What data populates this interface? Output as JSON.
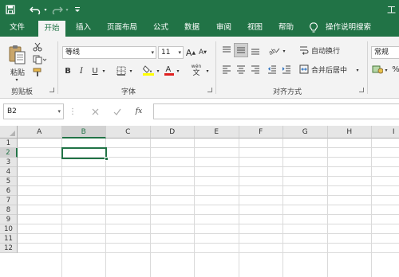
{
  "quick_access": {
    "save_icon": "save-icon",
    "undo_icon": "undo-icon",
    "redo_icon": "redo-icon",
    "customize_icon": "customize-qat-icon"
  },
  "title_right": "工",
  "tabs": [
    {
      "label": "文件"
    },
    {
      "label": "开始",
      "active": true
    },
    {
      "label": "插入"
    },
    {
      "label": "页面布局"
    },
    {
      "label": "公式"
    },
    {
      "label": "数据"
    },
    {
      "label": "审阅"
    },
    {
      "label": "视图"
    },
    {
      "label": "帮助"
    }
  ],
  "tell_me": "操作说明搜索",
  "ribbon": {
    "clipboard": {
      "paste_label": "粘贴",
      "group_label": "剪贴板"
    },
    "font": {
      "font_name": "等线",
      "font_size": "11",
      "bold": "B",
      "italic": "I",
      "underline": "U",
      "grow": "A",
      "shrink": "A",
      "wen": "wén",
      "group_label": "字体"
    },
    "alignment": {
      "wrap_text": "自动换行",
      "merge_center": "合并后居中",
      "group_label": "对齐方式"
    },
    "number": {
      "format": "常规",
      "percent": "%"
    }
  },
  "formula_bar": {
    "name_box": "B2",
    "fx": "fx",
    "formula": ""
  },
  "grid": {
    "columns": [
      "A",
      "B",
      "C",
      "D",
      "E",
      "F",
      "G",
      "H",
      "I"
    ],
    "rows": [
      "1",
      "2",
      "3",
      "4",
      "5",
      "6",
      "7",
      "8",
      "9",
      "10",
      "11",
      "12"
    ],
    "selected_column": "B",
    "selected_row": "2"
  },
  "colors": {
    "accent": "#217346"
  }
}
